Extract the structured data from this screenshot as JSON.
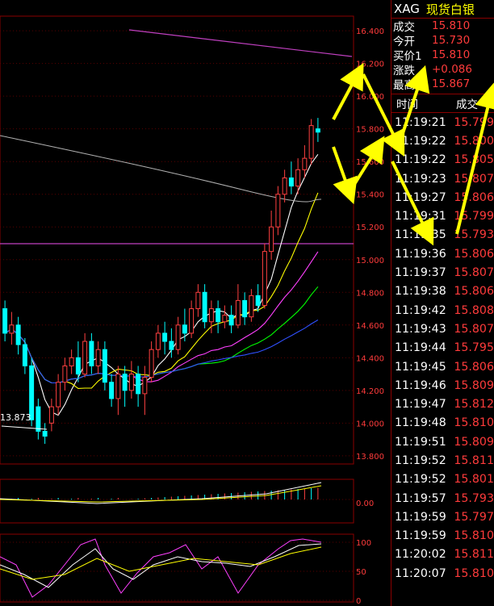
{
  "header": {
    "symbol": "XAG",
    "name": "现货白银"
  },
  "quote": [
    {
      "label": "成交",
      "value": "15.810"
    },
    {
      "label": "今开",
      "value": "15.730"
    },
    {
      "label": "买价1",
      "value": "15.810"
    },
    {
      "label": "涨跌",
      "value": "+0.086"
    },
    {
      "label": "最高",
      "value": "15.867"
    }
  ],
  "trades_header": {
    "time": "时间",
    "price": "成交"
  },
  "trades": [
    {
      "time": "11:19:21",
      "price": "15.799"
    },
    {
      "time": "11:19:22",
      "price": "15.800"
    },
    {
      "time": "11:19:22",
      "price": "15.805"
    },
    {
      "time": "11:19:23",
      "price": "15.807"
    },
    {
      "time": "11:19:27",
      "price": "15.806"
    },
    {
      "time": "11:19:31",
      "price": "15.799"
    },
    {
      "time": "11:19:35",
      "price": "15.793"
    },
    {
      "time": "11:19:36",
      "price": "15.806"
    },
    {
      "time": "11:19:37",
      "price": "15.807"
    },
    {
      "time": "11:19:38",
      "price": "15.806"
    },
    {
      "time": "11:19:42",
      "price": "15.808"
    },
    {
      "time": "11:19:43",
      "price": "15.807"
    },
    {
      "time": "11:19:44",
      "price": "15.795"
    },
    {
      "time": "11:19:45",
      "price": "15.806"
    },
    {
      "time": "11:19:46",
      "price": "15.809"
    },
    {
      "time": "11:19:47",
      "price": "15.812"
    },
    {
      "time": "11:19:48",
      "price": "15.810"
    },
    {
      "time": "11:19:51",
      "price": "15.809"
    },
    {
      "time": "11:19:52",
      "price": "15.811"
    },
    {
      "time": "11:19:52",
      "price": "15.801"
    },
    {
      "time": "11:19:57",
      "price": "15.793"
    },
    {
      "time": "11:19:59",
      "price": "15.797"
    },
    {
      "time": "11:19:59",
      "price": "15.810"
    },
    {
      "time": "11:20:02",
      "price": "15.811"
    },
    {
      "time": "11:20:07",
      "price": "15.810"
    }
  ],
  "chart_data": {
    "type": "candlestick",
    "price_axis": {
      "ticks": [
        "16.400",
        "16.200",
        "16.000",
        "15.800",
        "15.600",
        "15.400",
        "15.200",
        "15.000",
        "14.800",
        "14.600",
        "14.400",
        "14.200",
        "14.000",
        "13.800"
      ],
      "min": 13.75,
      "max": 16.45
    },
    "low_label": "13.873",
    "volume_axis": {
      "ticks": [
        "0.00"
      ]
    },
    "oscillator_axis": {
      "ticks": [
        "100",
        "50",
        "0"
      ]
    },
    "candles": [
      [
        14.7,
        14.55,
        14.75,
        14.5
      ],
      [
        14.55,
        14.6,
        14.68,
        14.48
      ],
      [
        14.6,
        14.48,
        14.65,
        14.42
      ],
      [
        14.48,
        14.35,
        14.52,
        14.3
      ],
      [
        14.35,
        14.02,
        14.4,
        13.98
      ],
      [
        14.1,
        13.95,
        14.15,
        13.9
      ],
      [
        13.95,
        13.92,
        14.0,
        13.873
      ],
      [
        14.0,
        14.1,
        14.15,
        13.95
      ],
      [
        14.1,
        14.25,
        14.3,
        14.05
      ],
      [
        14.25,
        14.35,
        14.4,
        14.2
      ],
      [
        14.35,
        14.4,
        14.45,
        14.3
      ],
      [
        14.4,
        14.3,
        14.5,
        14.25
      ],
      [
        14.3,
        14.5,
        14.55,
        14.28
      ],
      [
        14.5,
        14.35,
        14.55,
        14.3
      ],
      [
        14.35,
        14.45,
        14.5,
        14.3
      ],
      [
        14.45,
        14.25,
        14.5,
        14.2
      ],
      [
        14.25,
        14.15,
        14.3,
        14.1
      ],
      [
        14.15,
        14.3,
        14.35,
        14.05
      ],
      [
        14.3,
        14.2,
        14.35,
        14.1
      ],
      [
        14.2,
        14.3,
        14.38,
        14.15
      ],
      [
        14.3,
        14.18,
        14.35,
        14.1
      ],
      [
        14.18,
        14.28,
        14.35,
        14.05
      ],
      [
        14.28,
        14.45,
        14.5,
        14.25
      ],
      [
        14.45,
        14.55,
        14.6,
        14.4
      ],
      [
        14.55,
        14.5,
        14.62,
        14.42
      ],
      [
        14.5,
        14.45,
        14.58,
        14.4
      ],
      [
        14.45,
        14.6,
        14.65,
        14.42
      ],
      [
        14.6,
        14.55,
        14.7,
        14.5
      ],
      [
        14.55,
        14.7,
        14.75,
        14.52
      ],
      [
        14.7,
        14.8,
        14.85,
        14.65
      ],
      [
        14.8,
        14.62,
        14.85,
        14.58
      ],
      [
        14.62,
        14.7,
        14.75,
        14.55
      ],
      [
        14.7,
        14.62,
        14.75,
        14.55
      ],
      [
        14.62,
        14.66,
        14.72,
        14.58
      ],
      [
        14.66,
        14.6,
        14.72,
        14.55
      ],
      [
        14.6,
        14.75,
        14.85,
        14.58
      ],
      [
        14.75,
        14.65,
        14.8,
        14.6
      ],
      [
        14.65,
        14.78,
        14.82,
        14.62
      ],
      [
        14.78,
        14.72,
        14.85,
        14.68
      ],
      [
        14.72,
        15.05,
        15.1,
        14.7
      ],
      [
        15.05,
        15.2,
        15.3,
        15.0
      ],
      [
        15.2,
        15.4,
        15.45,
        15.15
      ],
      [
        15.4,
        15.5,
        15.55,
        15.35
      ],
      [
        15.5,
        15.45,
        15.6,
        15.4
      ],
      [
        15.45,
        15.55,
        15.62,
        15.4
      ],
      [
        15.55,
        15.62,
        15.7,
        15.5
      ],
      [
        15.62,
        15.82,
        15.86,
        15.58
      ],
      [
        15.8,
        15.78,
        15.867,
        15.72
      ]
    ]
  }
}
